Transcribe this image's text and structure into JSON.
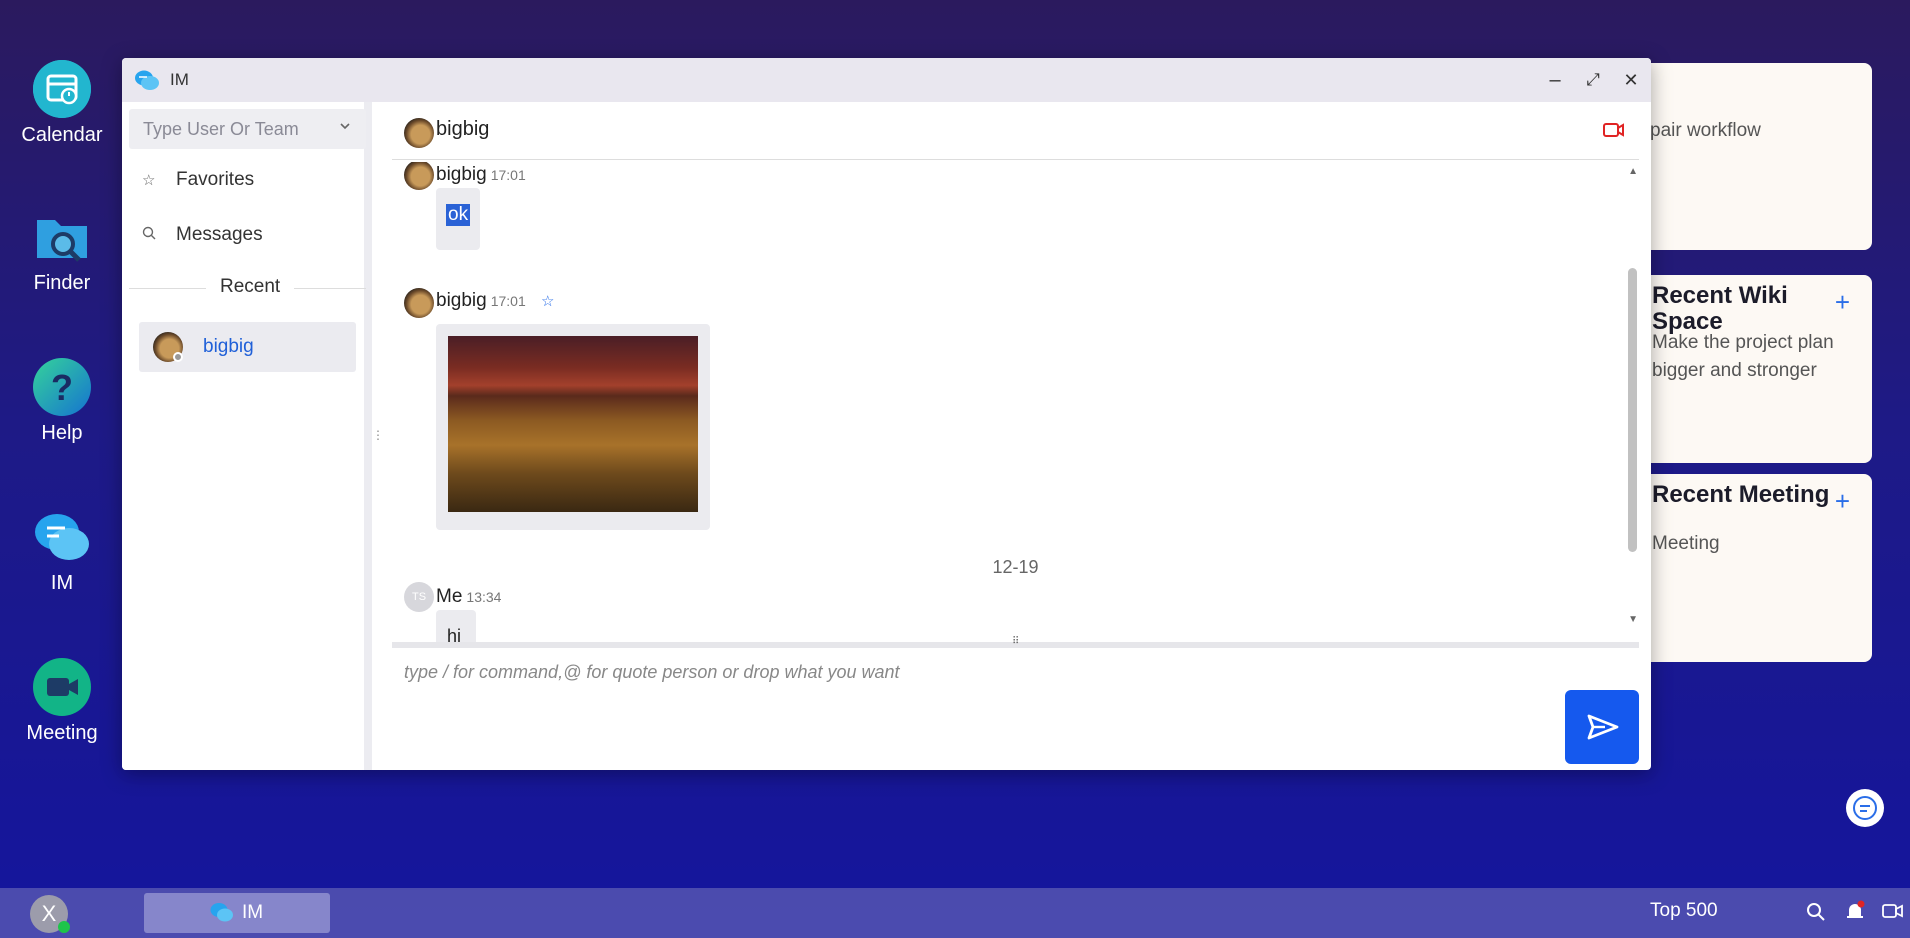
{
  "desktop": {
    "icons": [
      {
        "label": "Calendar"
      },
      {
        "label": "Finder"
      },
      {
        "label": "Help"
      },
      {
        "label": "IM"
      },
      {
        "label": "Meeting"
      }
    ]
  },
  "widgets": {
    "workflow": {
      "subtitle": "pair workflow"
    },
    "wiki": {
      "title": "Recent Wiki Space",
      "subtitle": "Make the project plan bigger and stronger",
      "add": "+"
    },
    "meeting": {
      "title": "Recent Meeting",
      "subtitle": "Meeting",
      "add": "+"
    }
  },
  "window": {
    "title": "IM",
    "minimize": "–",
    "maximize": "⤢",
    "close": "✕"
  },
  "sidebar": {
    "search_placeholder": "Type User Or Team",
    "favorites": "Favorites",
    "messages": "Messages",
    "recent_label": "Recent",
    "recent_items": [
      {
        "name": "bigbig"
      }
    ]
  },
  "chat": {
    "contact": "bigbig",
    "messages": [
      {
        "sender": "bigbig",
        "time": "17:01",
        "text": "ok"
      },
      {
        "sender": "bigbig",
        "time": "17:01",
        "type": "image"
      },
      {
        "sender": "Me",
        "avatar_text": "TS",
        "time": "13:34",
        "text": "hi"
      }
    ],
    "date_divider": "12-19",
    "input_placeholder": "type / for command,@ for quote person or drop what you want"
  },
  "taskbar": {
    "user_initial": "X",
    "task_label": "IM",
    "top_label": "Top 500"
  },
  "colors": {
    "accent": "#1559ee",
    "link": "#2060d8",
    "selection": "#2a62d6",
    "video_icon": "#e02424",
    "online": "#1ec44a"
  }
}
